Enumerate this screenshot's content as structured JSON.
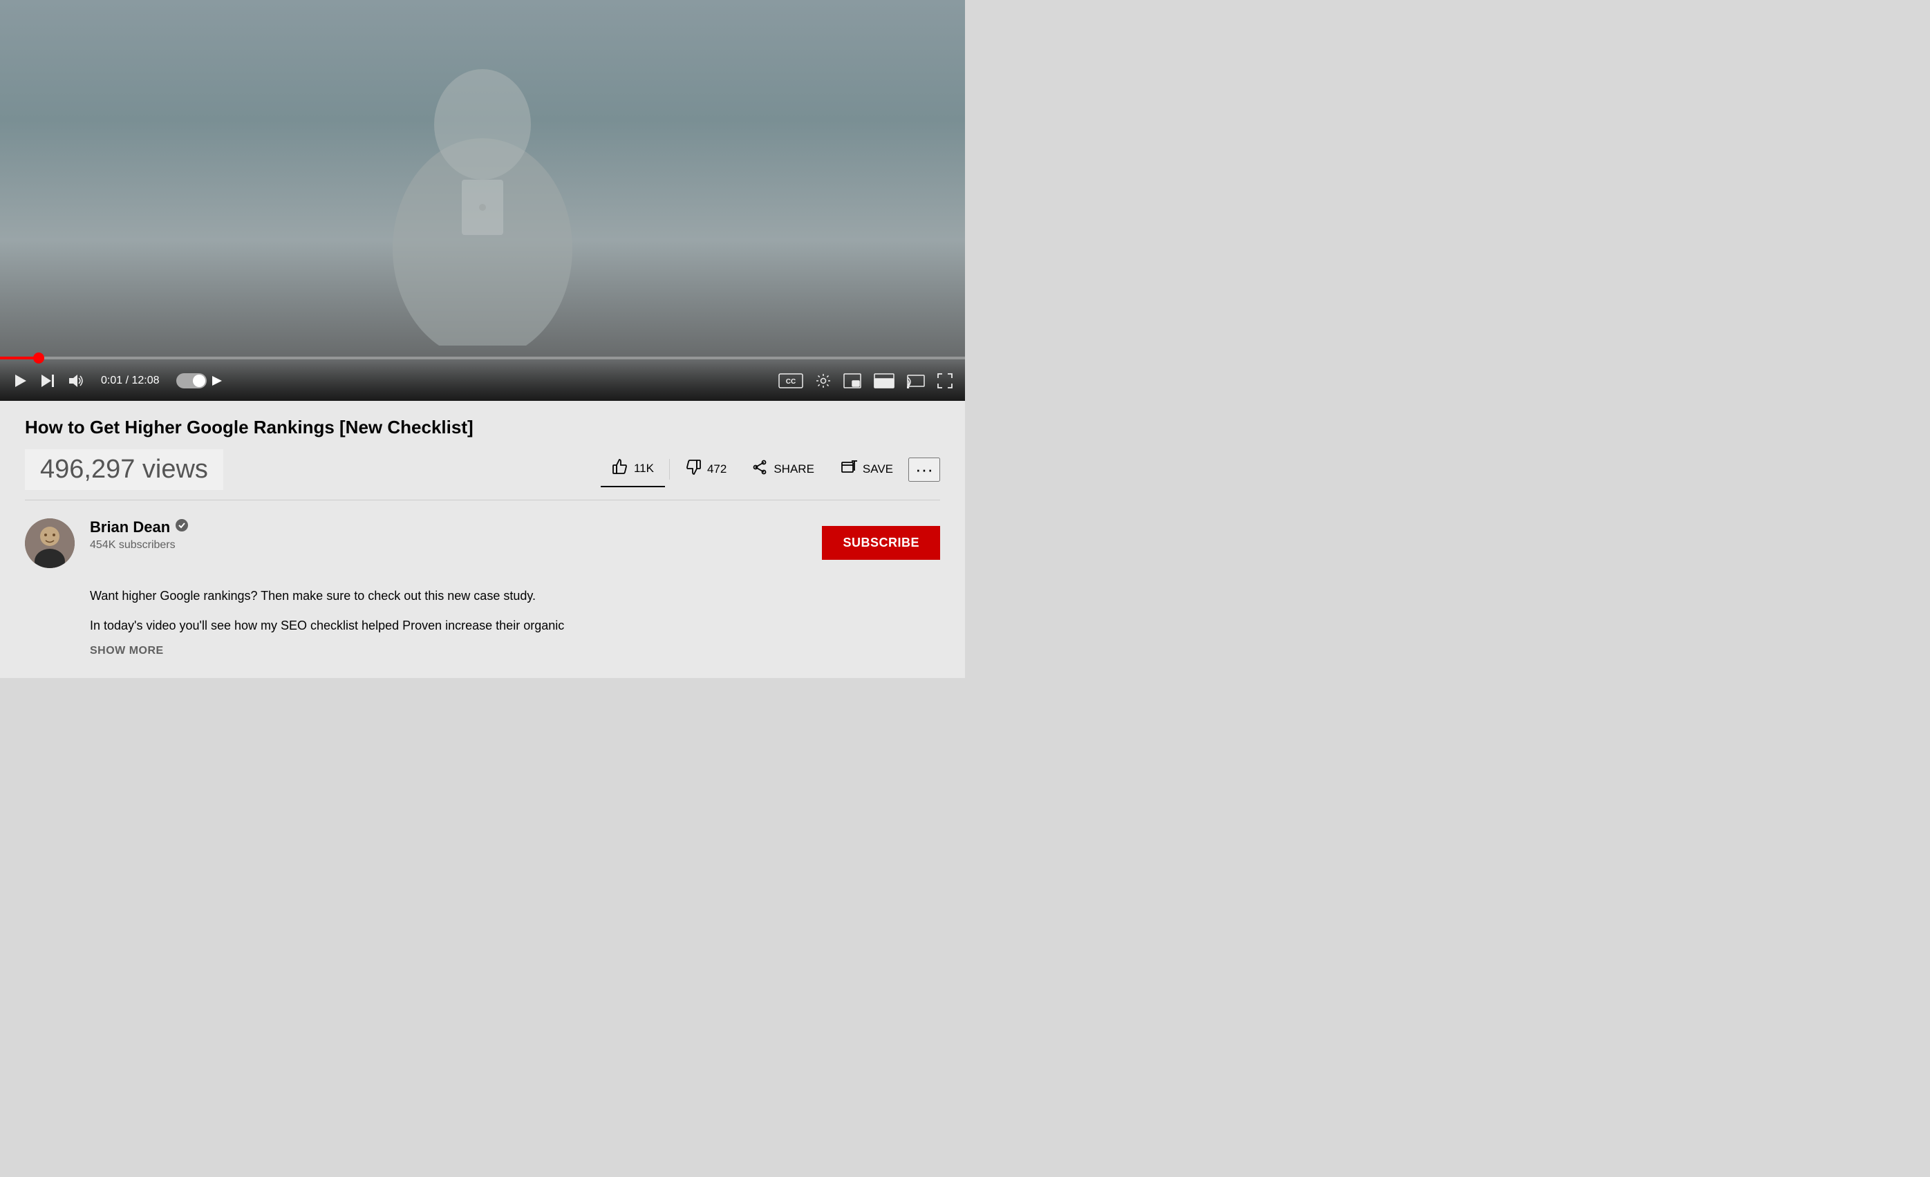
{
  "video": {
    "title": "How to Get Higher Google Rankings [New Checklist]",
    "views": "496,297 views",
    "time_current": "0:01",
    "time_total": "12:08",
    "progress_percent": 4
  },
  "actions": {
    "like_count": "11K",
    "dislike_count": "472",
    "share_label": "SHARE",
    "save_label": "SAVE",
    "more_label": "..."
  },
  "channel": {
    "name": "Brian Dean",
    "subscribers": "454K subscribers",
    "subscribe_label": "SUBSCRIBE"
  },
  "description": {
    "line1": "Want higher Google rankings? Then make sure to check out this new case study.",
    "line2": "In today's video you'll see how my SEO checklist helped Proven increase their organic",
    "show_more": "SHOW MORE"
  },
  "controls": {
    "play_icon": "▶",
    "next_icon": "⏭",
    "volume_icon": "🔊",
    "autoplay_icon": "▶",
    "cc_icon": "CC",
    "settings_icon": "⚙",
    "miniplayer_icon": "⧉",
    "theater_icon": "▭",
    "cast_icon": "⬡",
    "fullscreen_icon": "⛶"
  },
  "colors": {
    "subscribe_bg": "#c00",
    "progress_fill": "#f00",
    "underline": "#030303"
  }
}
